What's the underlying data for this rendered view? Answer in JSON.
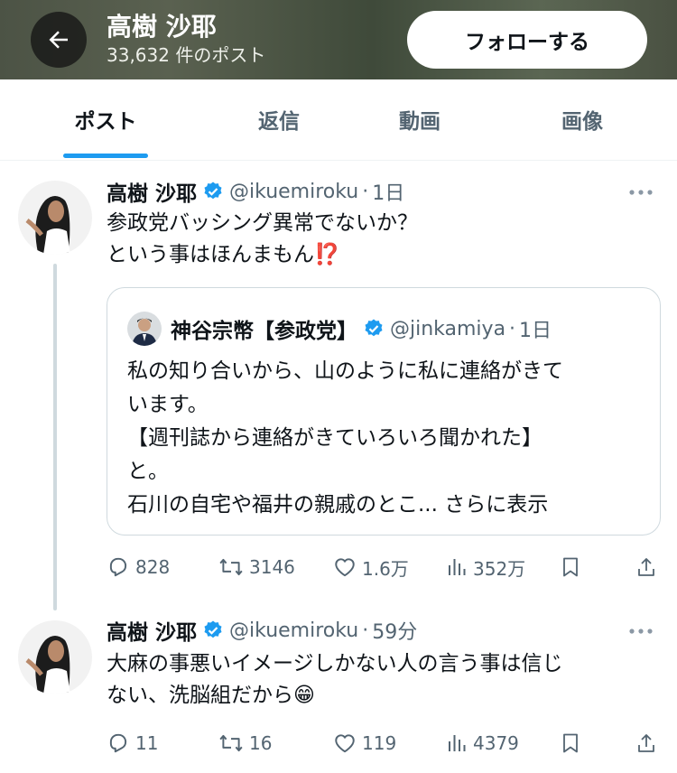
{
  "header": {
    "title": "高樹 沙耶",
    "post_count": "33,632 件のポスト",
    "follow_label": "フォローする"
  },
  "tabs": [
    {
      "label": "ポスト",
      "active": true
    },
    {
      "label": "返信",
      "active": false
    },
    {
      "label": "動画",
      "active": false
    },
    {
      "label": "画像",
      "active": false
    }
  ],
  "colors": {
    "accent": "#1d9bf0",
    "text": "#0f1419",
    "secondary": "#536471"
  },
  "posts": [
    {
      "author": "高樹 沙耶",
      "handle": "@ikuemiroku",
      "time": "1日",
      "lines": [
        "参政党バッシング異常でないか？",
        "という事はほんまもん⁉️"
      ],
      "quote": {
        "author": "神谷宗幣【参政党】",
        "handle": "@jinkamiya",
        "time": "1日",
        "lines": [
          "私の知り合いから、山のように私に連絡がきて",
          "います。",
          "【週刊誌から連絡がきていろいろ聞かれた】",
          "と。",
          "石川の自宅や福井の親戚のとこ..."
        ],
        "show_more": "さらに表示"
      },
      "stats": {
        "replies": "828",
        "reposts": "3146",
        "likes": "1.6万",
        "views": "352万"
      }
    },
    {
      "author": "高樹 沙耶",
      "handle": "@ikuemiroku",
      "time": "59分",
      "lines": [
        "大麻の事悪いイメージしかない人の言う事は信じ",
        "ない、洗脳組だから😁"
      ],
      "stats": {
        "replies": "11",
        "reposts": "16",
        "likes": "119",
        "views": "4379"
      }
    }
  ]
}
